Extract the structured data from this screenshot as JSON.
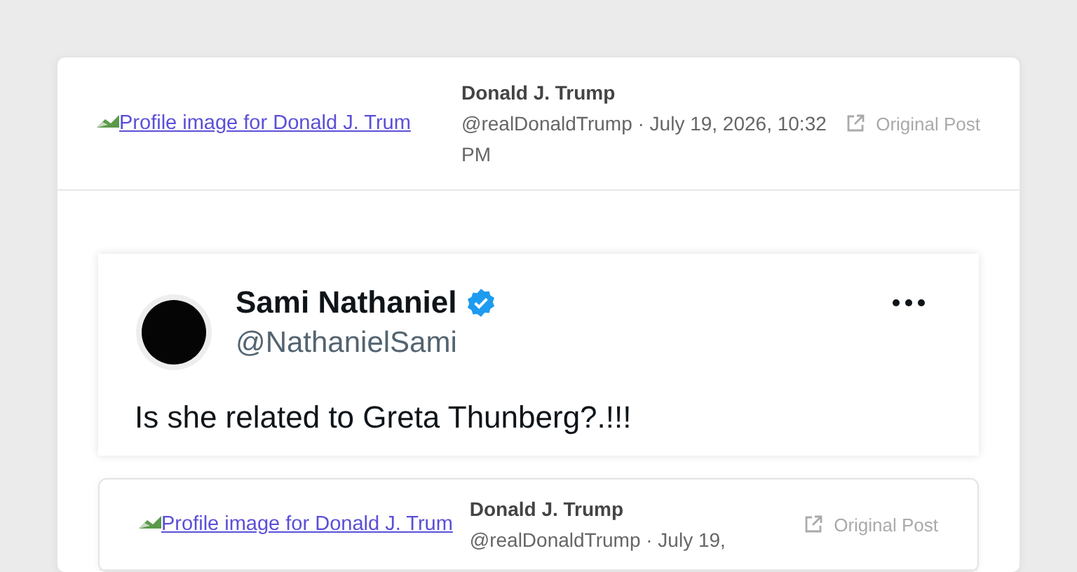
{
  "posts": [
    {
      "avatar_alt": "Profile image for Donald J. Trum",
      "author": "Donald J. Trump",
      "meta": "@realDonaldTrump · July 19, 2026, 10:32 PM",
      "link": "Original Post",
      "embed": {
        "name": "Sami Nathaniel",
        "verified": true,
        "handle": "@NathanielSami",
        "text": "Is she related to Greta Thunberg?.!!!"
      }
    },
    {
      "avatar_alt": "Profile image for Donald J. Trum",
      "author": "Donald J. Trump",
      "meta": "@realDonaldTrump · July 19,",
      "link": "Original Post"
    }
  ]
}
